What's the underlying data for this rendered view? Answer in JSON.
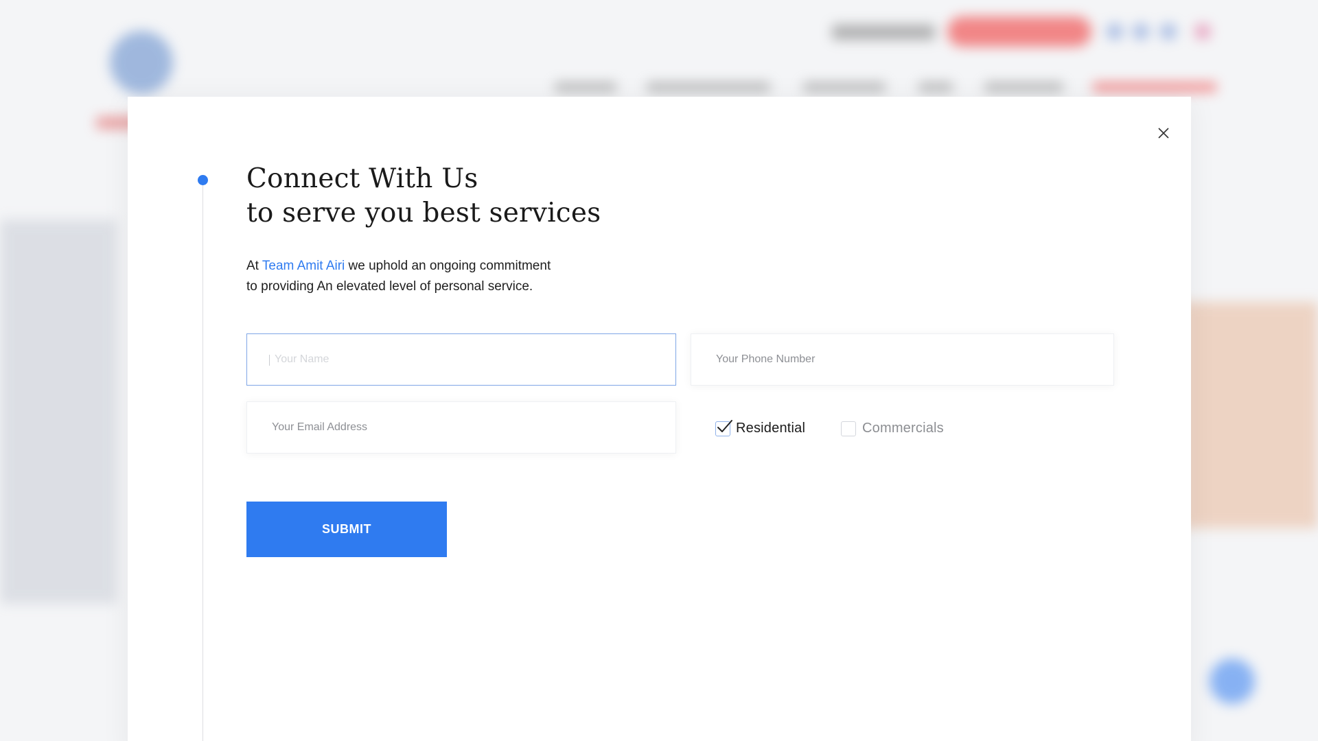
{
  "modal": {
    "title_line1": "Connect With Us",
    "title_line2": "to serve you best services",
    "desc_prefix": "At ",
    "brand_name": "Team Amit Airi",
    "desc_suffix_line1": " we uphold an ongoing commitment",
    "desc_line2": "to providing An elevated level of personal service.",
    "name_placeholder": "Your Name",
    "phone_placeholder": "Your Phone Number",
    "email_placeholder": "Your Email Address",
    "checkbox_residential": {
      "label": "Residential",
      "checked": true
    },
    "checkbox_commercial": {
      "label": "Commercials",
      "checked": false
    },
    "submit_label": "SUBMIT"
  },
  "colors": {
    "accent": "#2f7bf0",
    "backdrop_red": "#ef2b2b"
  },
  "icons": {
    "close": "close-icon",
    "check": "checkmark-icon"
  }
}
